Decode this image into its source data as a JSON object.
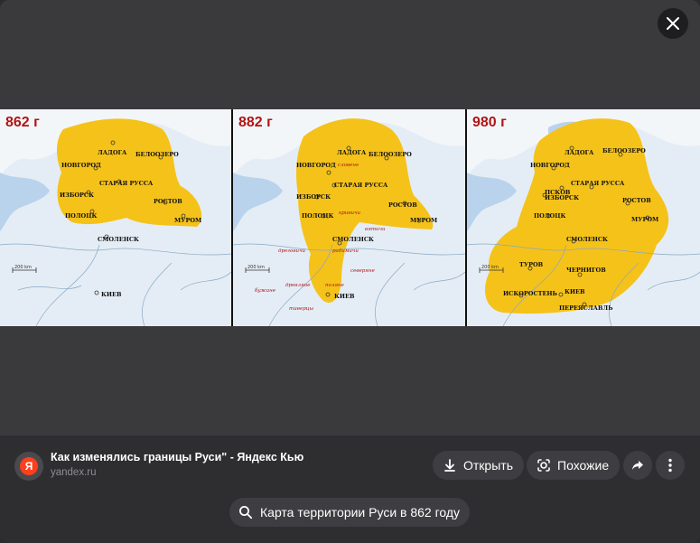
{
  "viewer": {
    "close_icon": "close-icon"
  },
  "image": {
    "panels": [
      {
        "year": "862 г",
        "cities": [
          "Ладога",
          "Белоозеро",
          "Новгород",
          "Старая Русса",
          "Изборск",
          "Ростов",
          "Полоцк",
          "Муром",
          "Смоленск",
          "Киев"
        ],
        "tribes": [],
        "scale": "200 km"
      },
      {
        "year": "882 г",
        "cities": [
          "Ладога",
          "Белоозеро",
          "Новгород",
          "Старая Русса",
          "Изборск",
          "Ростов",
          "Полоцк",
          "Муром",
          "Смоленск",
          "Киев"
        ],
        "tribes": [
          "словене",
          "кривичи",
          "вятичи",
          "радимичи",
          "дреговичи",
          "северяне",
          "древляне",
          "поляне",
          "бужане",
          "тиверцы"
        ],
        "scale": "200 km"
      },
      {
        "year": "980 г",
        "cities": [
          "Ладога",
          "Белоозеро",
          "Новгород",
          "Псков",
          "Старая Русса",
          "Изборск",
          "Ростов",
          "Полоцк",
          "Муром",
          "Смоленск",
          "Туров",
          "Чернигов",
          "Искоростень",
          "Киев",
          "Переяславль"
        ],
        "tribes": [],
        "scale": "200 km"
      }
    ],
    "territory_color": "#f5c21a"
  },
  "source": {
    "favicon_letter": "Я",
    "title": "Как изменялись границы Руси\" - Яндекс Кью",
    "domain": "yandex.ru"
  },
  "actions": {
    "open_label": "Открыть",
    "similar_label": "Похожие",
    "share_icon": "share-icon",
    "more_icon": "more-icon"
  },
  "search_chip": {
    "label": "Карта территории Руси в 862 году",
    "icon": "search-icon"
  }
}
